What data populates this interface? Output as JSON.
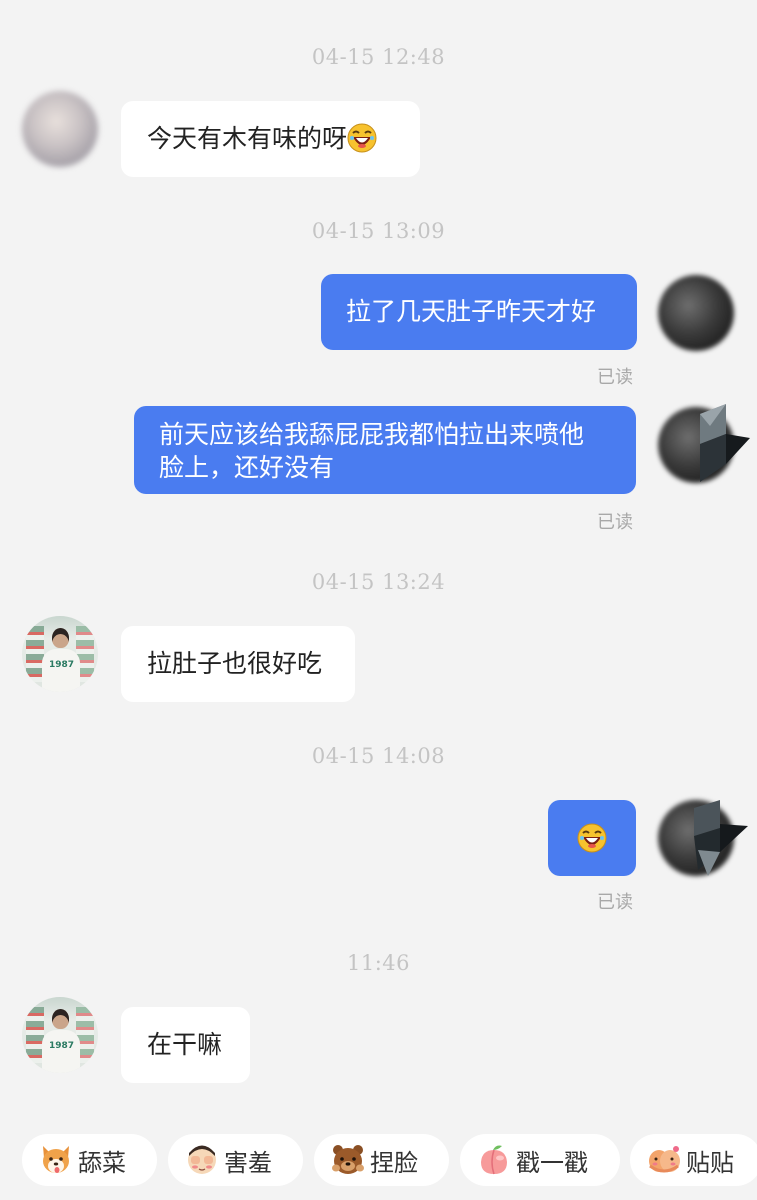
{
  "messages": [
    {
      "type": "timestamp",
      "text": "04-15 12:48"
    },
    {
      "type": "incoming",
      "text": "今天有木有味的呀",
      "emoji": "laughing-emoji"
    },
    {
      "type": "timestamp",
      "text": "04-15 13:09"
    },
    {
      "type": "outgoing",
      "text": "拉了几天肚子昨天才好",
      "status": "已读"
    },
    {
      "type": "outgoing",
      "text_line1": "前天应该给我舔屁屁我都怕拉出来喷他",
      "text_line2": "脸上，还好没有",
      "status": "已读"
    },
    {
      "type": "timestamp",
      "text": "04-15 13:24"
    },
    {
      "type": "incoming",
      "text": "拉肚子也很好吃"
    },
    {
      "type": "timestamp",
      "text": "04-15 14:08"
    },
    {
      "type": "outgoing",
      "emoji": "laughing-emoji",
      "status": "已读"
    },
    {
      "type": "timestamp",
      "text": "11:46"
    },
    {
      "type": "incoming",
      "text": "在干嘛"
    }
  ],
  "avatar_text": "1987",
  "reactions": [
    {
      "icon": "corgi-icon",
      "label": "舔菜"
    },
    {
      "icon": "cover-eyes-icon",
      "label": "害羞"
    },
    {
      "icon": "bear-icon",
      "label": "捏脸"
    },
    {
      "icon": "peach-icon",
      "label": "戳一戳"
    },
    {
      "icon": "hug-icon",
      "label": "贴贴"
    }
  ],
  "colors": {
    "background": "#f3f3f3",
    "outgoing_bubble": "#4a7cf0",
    "incoming_bubble": "#ffffff",
    "timestamp": "#c4c4c4",
    "read_status": "#a8a8a8"
  }
}
